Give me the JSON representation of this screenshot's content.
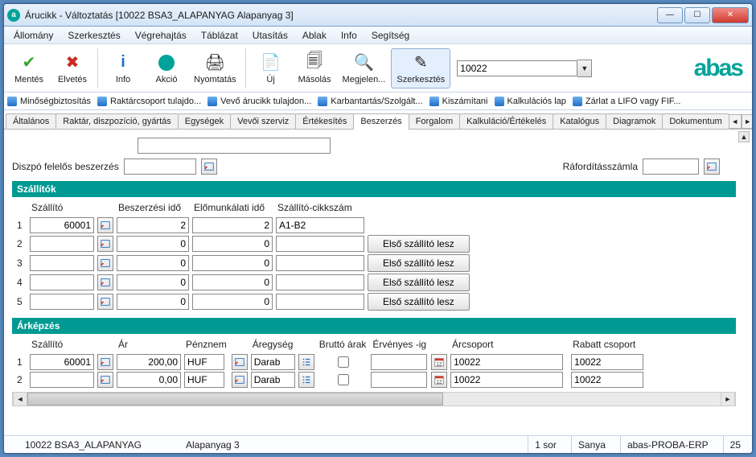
{
  "window": {
    "title": "Árucikk - Változtatás  [10022   BSA3_ALAPANYAG   Alapanyag 3]"
  },
  "menu": [
    "Állomány",
    "Szerkesztés",
    "Végrehajtás",
    "Táblázat",
    "Utasítás",
    "Ablak",
    "Info",
    "Segítség"
  ],
  "toolbar": {
    "save": "Mentés",
    "discard": "Elvetés",
    "info": "Info",
    "action": "Akció",
    "print": "Nyomtatás",
    "new": "Új",
    "copy": "Másolás",
    "view": "Megjelen...",
    "edit": "Szerkesztés",
    "combo_value": "10022",
    "logo": "abas"
  },
  "quickbar": [
    "Minőségbiztosítás",
    "Raktárcsoport tulajdo...",
    "Vevő árucikk tulajdon...",
    "Karbantartás/Szolgált...",
    "Kiszámítani",
    "Kalkulációs lap",
    "Zárlat a LIFO vagy FIF..."
  ],
  "tabs": [
    "Általános",
    "Raktár, diszpozíció, gyártás",
    "Egységek",
    "Vevői szerviz",
    "Értékesítés",
    "Beszerzés",
    "Forgalom",
    "Kalkuláció/Értékelés",
    "Katalógus",
    "Diagramok",
    "Dokumentum"
  ],
  "active_tab": "Beszerzés",
  "form": {
    "dispo_label": "Diszpó felelős beszerzés",
    "dispo_value": "",
    "expense_label": "Ráfordításszámla",
    "expense_value": ""
  },
  "suppliers": {
    "header": "Szállítók",
    "cols": [
      "Szállító",
      "Beszerzési idő",
      "Előmunkálati idő",
      "Szállító-cikkszám"
    ],
    "rows": [
      {
        "n": "1",
        "supplier": "60001",
        "proc": "2",
        "prep": "2",
        "itemno": "A1-B2",
        "btn": ""
      },
      {
        "n": "2",
        "supplier": "",
        "proc": "0",
        "prep": "0",
        "itemno": "",
        "btn": "Első szállító lesz"
      },
      {
        "n": "3",
        "supplier": "",
        "proc": "0",
        "prep": "0",
        "itemno": "",
        "btn": "Első szállító lesz"
      },
      {
        "n": "4",
        "supplier": "",
        "proc": "0",
        "prep": "0",
        "itemno": "",
        "btn": "Első szállító lesz"
      },
      {
        "n": "5",
        "supplier": "",
        "proc": "0",
        "prep": "0",
        "itemno": "",
        "btn": "Első szállító lesz"
      }
    ]
  },
  "pricing": {
    "header": "Árképzés",
    "cols": [
      "Szállító",
      "Ár",
      "Pénznem",
      "Áregység",
      "Bruttó árak",
      "Érvényes -ig",
      "Árcsoport",
      "Rabatt csoport"
    ],
    "rows": [
      {
        "n": "1",
        "supplier": "60001",
        "price": "200,00",
        "currency": "HUF",
        "unit": "Darab",
        "gross": false,
        "valid": "",
        "pricegroup": "10022",
        "rabatt": "10022"
      },
      {
        "n": "2",
        "supplier": "",
        "price": "0,00",
        "currency": "HUF",
        "unit": "Darab",
        "gross": false,
        "valid": "",
        "pricegroup": "10022",
        "rabatt": "10022"
      }
    ]
  },
  "status": {
    "code": "10022 BSA3_ALAPANYAG",
    "name": "Alapanyag 3",
    "rows": "1 sor",
    "user": "Sanya",
    "db": "abas-PROBA-ERP",
    "num": "25"
  }
}
